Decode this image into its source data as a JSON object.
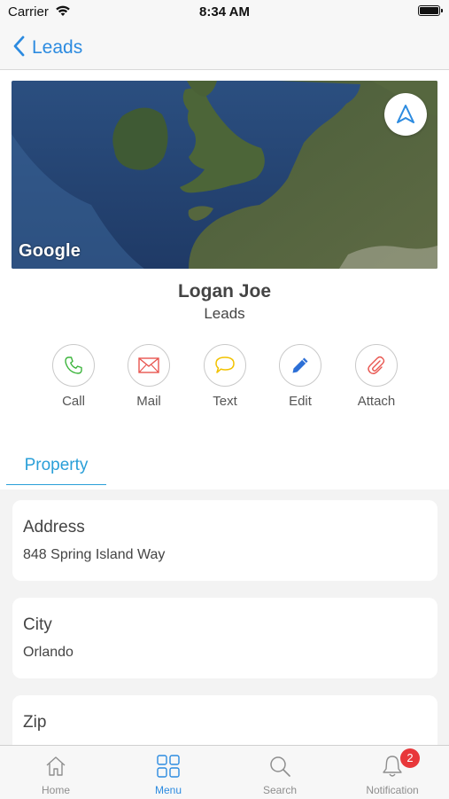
{
  "status_bar": {
    "carrier": "Carrier",
    "time": "8:34 AM"
  },
  "nav": {
    "back_label": "Leads"
  },
  "map": {
    "attribution": "Google"
  },
  "contact": {
    "name": "Logan Joe",
    "subtitle": "Leads"
  },
  "actions": [
    {
      "label": "Call",
      "icon": "phone-icon",
      "color": "#3db53d"
    },
    {
      "label": "Mail",
      "icon": "envelope-icon",
      "color": "#e8554f"
    },
    {
      "label": "Text",
      "icon": "chat-bubble-icon",
      "color": "#f2c200"
    },
    {
      "label": "Edit",
      "icon": "pencil-icon",
      "color": "#2c6fd6"
    },
    {
      "label": "Attach",
      "icon": "paperclip-icon",
      "color": "#e8554f"
    }
  ],
  "tab": {
    "label": "Property"
  },
  "fields": [
    {
      "title": "Address",
      "value": "848 Spring Island Way"
    },
    {
      "title": "City",
      "value": "Orlando"
    },
    {
      "title": "Zip",
      "value": ""
    }
  ],
  "tabbar": {
    "items": [
      {
        "label": "Home",
        "icon": "home-icon"
      },
      {
        "label": "Menu",
        "icon": "grid-icon",
        "active": true
      },
      {
        "label": "Search",
        "icon": "search-icon"
      },
      {
        "label": "Notification",
        "icon": "bell-icon",
        "badge": "2"
      }
    ]
  },
  "colors": {
    "accent": "#2c8be0",
    "tab_accent": "#2a9fd8",
    "badge": "#e8373a"
  }
}
